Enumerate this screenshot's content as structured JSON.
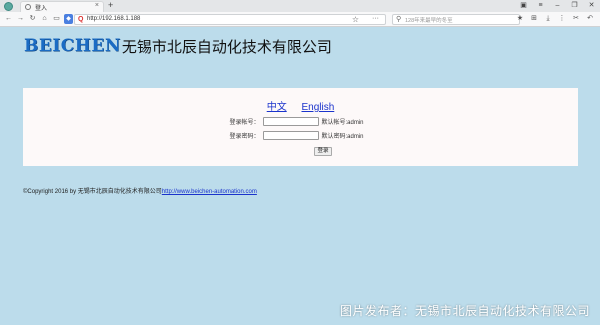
{
  "browser": {
    "tab_title": "登入",
    "url": "http://192.168.1.188",
    "search_placeholder": "128年来最早的冬至",
    "new_tab": "+",
    "tab_close": "×"
  },
  "brand": {
    "name_en": "BEICHEN",
    "name_cn": "无锡市北辰自动化技术有限公司"
  },
  "login": {
    "lang_cn": "中文",
    "lang_en": "English",
    "username_label": "登录帐号：",
    "username_value": "",
    "username_hint": "默认帐号:admin",
    "password_label": "登录密码：",
    "password_value": "",
    "password_hint": "默认密码:admin",
    "submit_label": "登录"
  },
  "footer": {
    "copyright": "©Copyright 2016 by 无锡市北辰自动化技术有限公司",
    "link": "http://www.beichen-automation.com"
  },
  "watermark": "图片发布者：无锡市北辰自动化技术有限公司",
  "colors": {
    "page_background": "#bcdceb",
    "panel_background": "#fdf9f9",
    "brand_blue": "#1b6cc4",
    "link_blue": "#1a33cc"
  }
}
